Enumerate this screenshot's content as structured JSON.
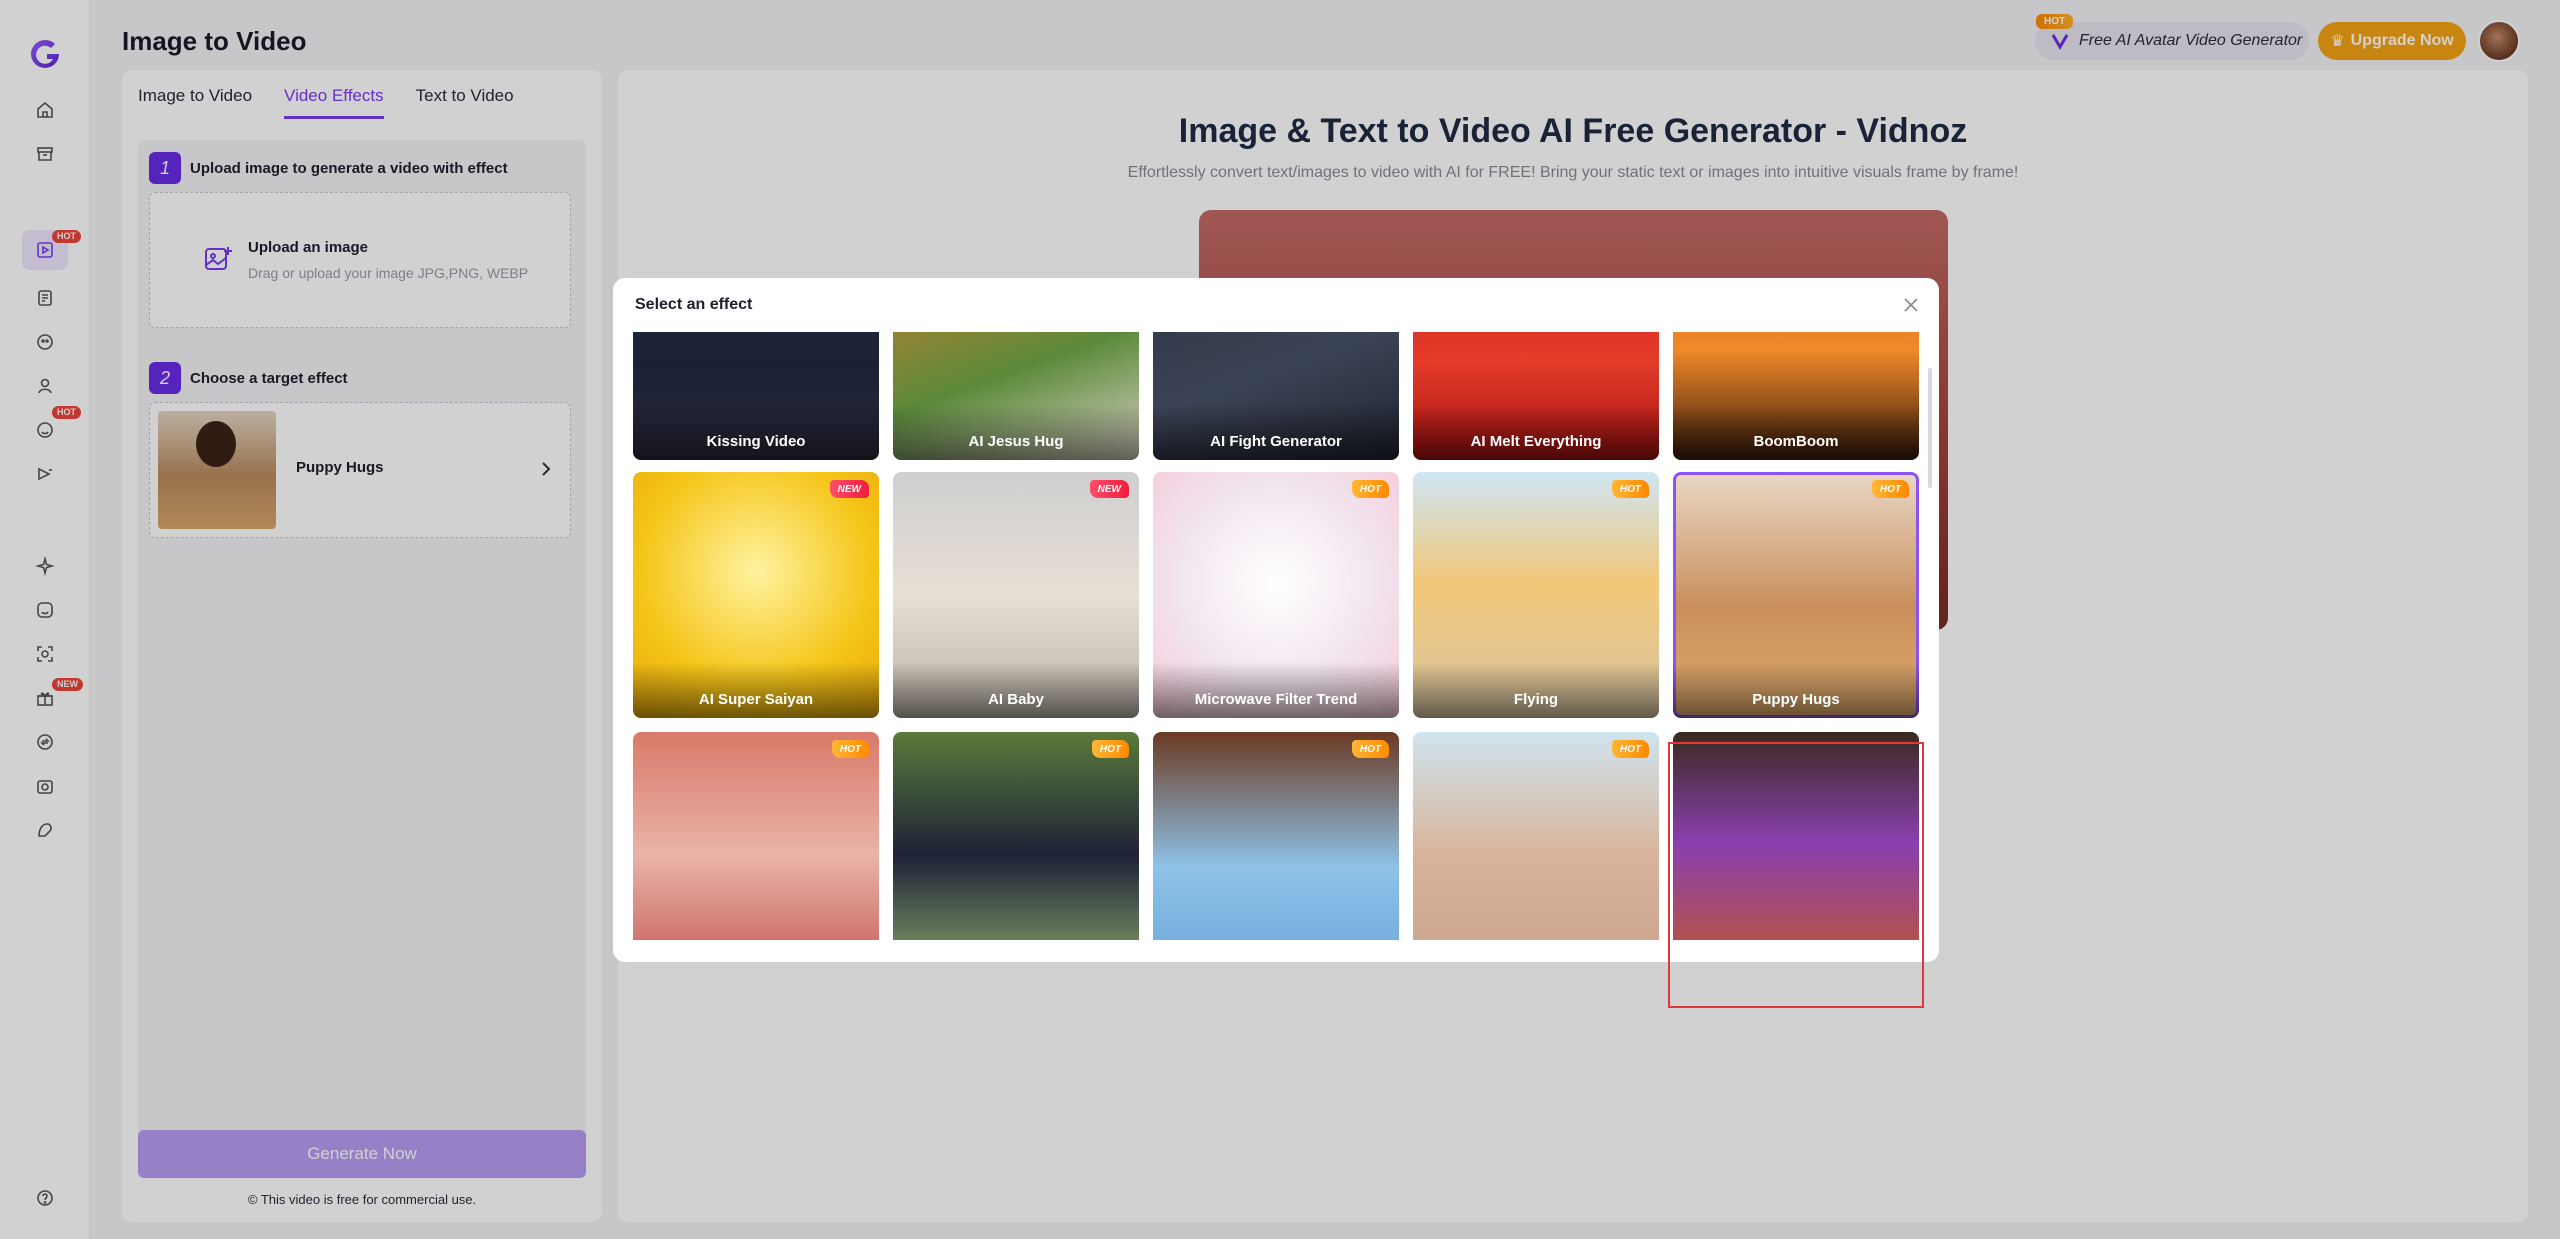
{
  "app": {
    "page_title": "Image to Video"
  },
  "header": {
    "hot_flag": "HOT",
    "avatar_promo": "Free AI Avatar Video Generator",
    "upgrade_label": "Upgrade Now",
    "brand_color": "#7a3cf0",
    "upgrade_color": "#f5a313"
  },
  "sidebar": {
    "badges": [
      "HOT",
      "HOT",
      "NEW"
    ],
    "icons": [
      "home-icon",
      "archive-icon",
      "image-to-video-icon",
      "document-video-icon",
      "face-swap-icon",
      "avatar-icon",
      "talking-photo-icon",
      "video-translate-icon",
      "sparkle-icon",
      "emoji-icon",
      "face-scan-icon",
      "gift-icon",
      "swap-icon",
      "camera-icon",
      "cartoon-icon",
      "help-icon"
    ]
  },
  "left_panel": {
    "tabs": [
      "Image to Video",
      "Video Effects",
      "Text to Video"
    ],
    "active_tab": "Video Effects",
    "step1": {
      "num": "1",
      "label": "Upload image to generate a video with effect"
    },
    "upload": {
      "title": "Upload an image",
      "subtitle": "Drag or upload your image JPG,PNG, WEBP"
    },
    "step2": {
      "num": "2",
      "label": "Choose a target effect"
    },
    "selected_effect": "Puppy Hugs",
    "generate_label": "Generate Now",
    "free_note": "This video is free for commercial use."
  },
  "right_panel": {
    "title": "Image & Text to Video AI Free Generator - Vidnoz",
    "subtitle": "Effortlessly convert text/images to video with AI for FREE! Bring your static text or images into intuitive visuals frame by frame!"
  },
  "modal": {
    "title": "Select an effect",
    "row1": [
      {
        "label": "Kissing Video"
      },
      {
        "label": "AI Jesus Hug"
      },
      {
        "label": "AI Fight Generator"
      },
      {
        "label": "AI Melt Everything"
      },
      {
        "label": "BoomBoom"
      }
    ],
    "row2": [
      {
        "label": "AI Super Saiyan",
        "tag": "NEW"
      },
      {
        "label": "AI Baby",
        "tag": "NEW"
      },
      {
        "label": "Microwave Filter Trend",
        "tag": "HOT"
      },
      {
        "label": "Flying",
        "tag": "HOT"
      },
      {
        "label": "Puppy Hugs",
        "tag": "HOT"
      }
    ],
    "row3_tags": [
      "HOT",
      "HOT",
      "HOT",
      "HOT"
    ]
  }
}
